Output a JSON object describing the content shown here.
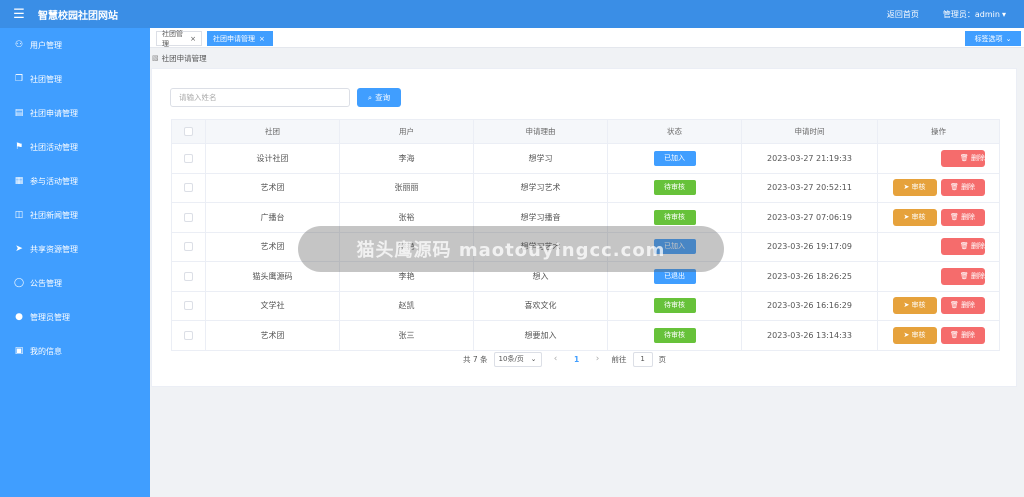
{
  "app": {
    "title": "智慧校园社团网站"
  },
  "header": {
    "home_link": "返回首页",
    "admin_label": "管理员：admin",
    "menu_icon": "hamburger-icon"
  },
  "sidebar": {
    "items": [
      {
        "label": "用户管理",
        "icon": "user-icon"
      },
      {
        "label": "社团管理",
        "icon": "copy-icon"
      },
      {
        "label": "社团申请管理",
        "icon": "document-icon"
      },
      {
        "label": "社团活动管理",
        "icon": "flag-icon"
      },
      {
        "label": "参与活动管理",
        "icon": "calendar-icon"
      },
      {
        "label": "社团新闻管理",
        "icon": "book-icon"
      },
      {
        "label": "共享资源管理",
        "icon": "send-icon"
      },
      {
        "label": "公告管理",
        "icon": "chat-icon"
      },
      {
        "label": "管理员管理",
        "icon": "person-icon"
      },
      {
        "label": "我的信息",
        "icon": "clipboard-icon"
      }
    ]
  },
  "tabs": [
    {
      "label": "社团管理",
      "active": false
    },
    {
      "label": "社团申请管理",
      "active": true
    }
  ],
  "tag_options": "标签选项",
  "breadcrumb": "社团申请管理",
  "search": {
    "placeholder": "请输入姓名",
    "button": "查询"
  },
  "table": {
    "headers": [
      "社团",
      "用户",
      "申请理由",
      "状态",
      "申请时间",
      "操作"
    ],
    "audit_label": "审核",
    "delete_label": "删除",
    "rows": [
      {
        "club": "设计社团",
        "user": "李海",
        "reason": "想学习",
        "status": "已加入",
        "status_color": "#409eff",
        "time": "2023-03-27 21:19:33",
        "audit": false
      },
      {
        "club": "艺术团",
        "user": "张丽丽",
        "reason": "想学习艺术",
        "status": "待审核",
        "status_color": "#67c23a",
        "time": "2023-03-27 20:52:11",
        "audit": true
      },
      {
        "club": "广播台",
        "user": "张裕",
        "reason": "想学习播音",
        "status": "待审核",
        "status_color": "#67c23a",
        "time": "2023-03-27 07:06:19",
        "audit": true
      },
      {
        "club": "艺术团",
        "user": "李艳",
        "reason": "想学习艺术",
        "status": "已加入",
        "status_color": "#409eff",
        "time": "2023-03-26 19:17:09",
        "audit": false
      },
      {
        "club": "猫头鹰源码",
        "user": "李艳",
        "reason": "想入",
        "status": "已退出",
        "status_color": "#409eff",
        "time": "2023-03-26 18:26:25",
        "audit": false
      },
      {
        "club": "文学社",
        "user": "赵凯",
        "reason": "喜欢文化",
        "status": "待审核",
        "status_color": "#67c23a",
        "time": "2023-03-26 16:16:29",
        "audit": true
      },
      {
        "club": "艺术团",
        "user": "张三",
        "reason": "想要加入",
        "status": "待审核",
        "status_color": "#67c23a",
        "time": "2023-03-26 13:14:33",
        "audit": true
      }
    ]
  },
  "pagination": {
    "total": "共 7 条",
    "page_size": "10条/页",
    "current": "1",
    "goto_label": "前往",
    "goto_value": "1",
    "page_suffix": "页"
  },
  "watermark": "猫头鹰源码 maotouyingcc.com"
}
